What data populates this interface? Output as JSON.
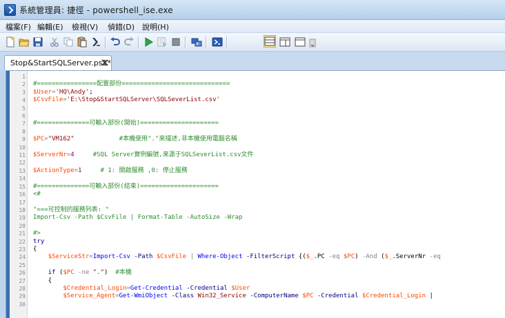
{
  "window": {
    "title": "系統管理員: 捷徑 - powershell_ise.exe"
  },
  "menu": [
    {
      "label": "檔案(F)",
      "name": "menu-file"
    },
    {
      "label": "編輯(E)",
      "name": "menu-edit"
    },
    {
      "label": "檢視(V)",
      "name": "menu-view"
    },
    {
      "label": "偵錯(D)",
      "name": "menu-debug"
    },
    {
      "label": "說明(H)",
      "name": "menu-help"
    }
  ],
  "toolbar": {
    "icons": [
      "new-file-icon",
      "open-folder-icon",
      "save-icon",
      "cut-icon",
      "copy-icon",
      "paste-icon",
      "clear-icon",
      "undo-icon",
      "redo-icon",
      "run-icon",
      "run-selection-icon",
      "stop-icon",
      "remote-powershell-icon",
      "powershell-icon",
      "layout-top-icon",
      "layout-right-icon",
      "layout-max-icon"
    ]
  },
  "tab": {
    "label": "Stop&StartSQLServer.ps1*"
  },
  "colors": {
    "comment": "#2e8b2e",
    "variable": "#ff4500",
    "string": "#8b0000",
    "command": "#0000ff",
    "parameter": "#000080",
    "operator": "#808080",
    "number": "#800080"
  },
  "code_lines": [
    {
      "n": "1",
      "t": []
    },
    {
      "n": "2",
      "t": [
        [
          "c",
          "#================配置部份============================="
        ]
      ]
    },
    {
      "n": "3",
      "t": [
        [
          "v",
          "$User"
        ],
        [
          "o",
          "="
        ],
        [
          "s",
          "'HQ\\Andy'"
        ],
        [
          "p",
          ";"
        ]
      ]
    },
    {
      "n": "4",
      "t": [
        [
          "v",
          "$CsvFile"
        ],
        [
          "o",
          "="
        ],
        [
          "s",
          "'E:\\Stop&StartSQLServer\\SQLSeverList.csv'"
        ]
      ]
    },
    {
      "n": "5",
      "t": []
    },
    {
      "n": "6",
      "t": []
    },
    {
      "n": "7",
      "t": [
        [
          "c",
          "#==============可輸入部份(開始)====================="
        ]
      ]
    },
    {
      "n": "8",
      "t": []
    },
    {
      "n": "9",
      "t": [
        [
          "v",
          "$PC"
        ],
        [
          "o",
          "="
        ],
        [
          "s",
          "\"VM162\""
        ],
        [
          "p",
          "            "
        ],
        [
          "c",
          "#本機使用\".\"來描述,非本機使用電腦名稱"
        ]
      ]
    },
    {
      "n": "10",
      "t": []
    },
    {
      "n": "11",
      "t": [
        [
          "v",
          "$ServerNr"
        ],
        [
          "o",
          "="
        ],
        [
          "n",
          "4"
        ],
        [
          "p",
          "     "
        ],
        [
          "c",
          "#SQL Server實例編號,來源于SQLSeverList.csv文件"
        ]
      ]
    },
    {
      "n": "12",
      "t": []
    },
    {
      "n": "13",
      "t": [
        [
          "v",
          "$ActionType"
        ],
        [
          "o",
          "="
        ],
        [
          "n",
          "1"
        ],
        [
          "p",
          "     "
        ],
        [
          "c",
          "# 1: 開啟服務 ,0: 停止服務"
        ]
      ]
    },
    {
      "n": "14",
      "t": []
    },
    {
      "n": "15",
      "t": [
        [
          "c",
          "#==============可輸入部份(結束)====================="
        ]
      ]
    },
    {
      "n": "16",
      "t": [
        [
          "c",
          "<#"
        ]
      ]
    },
    {
      "n": "17",
      "t": []
    },
    {
      "n": "18",
      "t": [
        [
          "c",
          "\"===可控制的服務列表: \""
        ]
      ]
    },
    {
      "n": "19",
      "t": [
        [
          "c",
          "Import-Csv -Path $CsvFile | Format-Table -AutoSize -Wrap"
        ]
      ]
    },
    {
      "n": "20",
      "t": []
    },
    {
      "n": "21",
      "t": [
        [
          "c",
          "#>"
        ]
      ]
    },
    {
      "n": "22",
      "t": [
        [
          "k",
          "try"
        ]
      ]
    },
    {
      "n": "23",
      "t": [
        [
          "p",
          "{"
        ]
      ]
    },
    {
      "n": "24",
      "t": [
        [
          "p",
          "    "
        ],
        [
          "v",
          "$ServiceStr"
        ],
        [
          "o",
          "="
        ],
        [
          "m",
          "Import-Csv"
        ],
        [
          "p",
          " "
        ],
        [
          "a",
          "-Path"
        ],
        [
          "p",
          " "
        ],
        [
          "v",
          "$CsvFile"
        ],
        [
          "p",
          " "
        ],
        [
          "o",
          "|"
        ],
        [
          "p",
          " "
        ],
        [
          "m",
          "Where-Object"
        ],
        [
          "p",
          " "
        ],
        [
          "a",
          "-FilterScript"
        ],
        [
          "p",
          " {("
        ],
        [
          "v",
          "$_"
        ],
        [
          "p",
          ".PC "
        ],
        [
          "o",
          "-eq"
        ],
        [
          "p",
          " "
        ],
        [
          "v",
          "$PC"
        ],
        [
          "p",
          ") "
        ],
        [
          "o",
          "-And"
        ],
        [
          "p",
          " ("
        ],
        [
          "v",
          "$_"
        ],
        [
          "p",
          ".ServerNr "
        ],
        [
          "o",
          "-eq"
        ]
      ]
    },
    {
      "n": "25",
      "t": []
    },
    {
      "n": "26",
      "t": [
        [
          "p",
          "    "
        ],
        [
          "k",
          "if"
        ],
        [
          "p",
          " ("
        ],
        [
          "v",
          "$PC"
        ],
        [
          "p",
          " "
        ],
        [
          "o",
          "-ne"
        ],
        [
          "p",
          " "
        ],
        [
          "s",
          "\".\""
        ],
        [
          "p",
          ")  "
        ],
        [
          "c",
          "#本機"
        ]
      ]
    },
    {
      "n": "27",
      "t": [
        [
          "p",
          "    {"
        ]
      ]
    },
    {
      "n": "28",
      "t": [
        [
          "p",
          "        "
        ],
        [
          "v",
          "$Credential_Login"
        ],
        [
          "o",
          "="
        ],
        [
          "m",
          "Get-Credential"
        ],
        [
          "p",
          " "
        ],
        [
          "a",
          "-Credential"
        ],
        [
          "p",
          " "
        ],
        [
          "v",
          "$User"
        ]
      ]
    },
    {
      "n": "29",
      "t": [
        [
          "p",
          "        "
        ],
        [
          "v",
          "$Service_Agent"
        ],
        [
          "o",
          "="
        ],
        [
          "m",
          "Get-WmiObject"
        ],
        [
          "p",
          " "
        ],
        [
          "a",
          "-Class"
        ],
        [
          "p",
          " "
        ],
        [
          "s",
          "Win32_Service"
        ],
        [
          "p",
          " "
        ],
        [
          "a",
          "-ComputerName"
        ],
        [
          "p",
          " "
        ],
        [
          "v",
          "$PC"
        ],
        [
          "p",
          " "
        ],
        [
          "a",
          "-Credential"
        ],
        [
          "p",
          " "
        ],
        [
          "v",
          "$Credential_Login"
        ],
        [
          "p",
          " |"
        ]
      ]
    },
    {
      "n": "30",
      "t": []
    }
  ]
}
